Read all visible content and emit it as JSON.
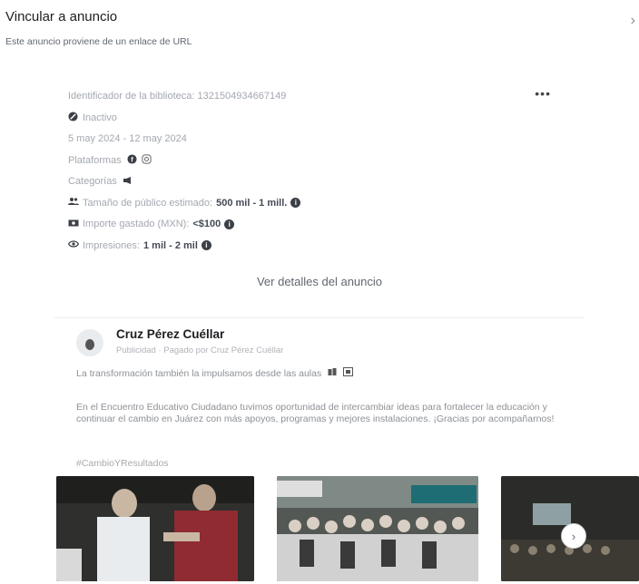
{
  "header": {
    "title": "Vincular a anuncio",
    "close_icon": "chevron-right-icon"
  },
  "subtitle": "Este anuncio proviene de un enlace de URL",
  "ad_info": {
    "library_id": "Identificador de la biblioteca: 1321504934667149",
    "status": "Inactivo",
    "dates": "5 may 2024 - 12 may 2024",
    "platforms_label": "Plataformas",
    "categories_label": "Categorías",
    "audience_label": "Tamaño de público estimado:",
    "audience_value": "500 mil - 1 mill.",
    "spend_label": "Importe gastado (MXN):",
    "spend_value": "<$100",
    "impressions_label": "Impresiones:",
    "impressions_value": "1 mil - 2 mil"
  },
  "details_link": "Ver detalles del anuncio",
  "post": {
    "page_name": "Cruz Pérez Cuéllar",
    "sponsored": "Publicidad · Pagado por Cruz Pérez Cuéllar",
    "caption": "La transformación también la impulsamos desde las aulas",
    "body": "En el Encuentro Educativo Ciudadano tuvimos oportunidad de intercambiar ideas para fortalecer la educación y continuar el cambio en Juárez con más apoyos, programas y mejores instalaciones. ¡Gracias por acompañarnos!",
    "hashtag": "#CambioYResultados",
    "next_icon": "chevron-right-icon"
  }
}
